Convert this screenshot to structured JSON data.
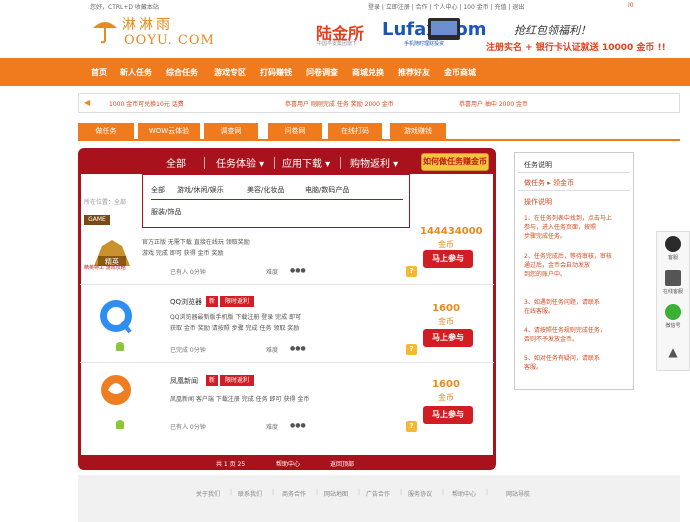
{
  "topbar": {
    "welcome": "您好，CTRL+D 收藏本站",
    "bookmark": "收藏本站",
    "user_links": "登录 | 立即注册 | 合作 | 个人中心 | 100 金币 | 充值 | 退出",
    "vip": "I0"
  },
  "header": {
    "logo_cn": "淋淋雨",
    "logo_en": "OOYU. COM",
    "lu_logo": "陆金所",
    "lu_sub": "中国平安集团旗下",
    "lufax": "Lufax.com",
    "lufax_sub": "手机随时理财投资",
    "slogan1": "抢红包领福利！",
    "slogan2": "注册实名 + 银行卡认证就送 10000 金币 !!"
  },
  "nav": [
    "首页",
    "新人任务",
    "综合任务",
    "游戏专区",
    "打码赚钱",
    "问卷调查",
    "商城兑换",
    "推荐好友",
    "金币商城"
  ],
  "notice": {
    "items": [
      "1000 金币可兑换10元 话费",
      "恭喜用户 刚刚完成 任务 奖励 2000 金币",
      "恭喜用户 抽中 2000 金币"
    ]
  },
  "subtabs": [
    "做任务",
    "WOW云体验",
    "调查网",
    "问卷网",
    "在线打码",
    "游戏赚钱"
  ],
  "panel": {
    "head_items": [
      "全部",
      "任务体验 ▾",
      "应用下载 ▾",
      "购物返利 ▾"
    ],
    "cta": "如何做任务赚金币"
  },
  "dropdown": {
    "row1": [
      "全部",
      "游戏/休闲/娱乐",
      "美容/化妆品",
      "电脑/数码产品"
    ],
    "row2": [
      "服装/饰品"
    ]
  },
  "breadcrumb": "所在位置：全部",
  "tasks": [
    {
      "tag": "GAME",
      "thumb_caption": "精英特工 游戏攻略",
      "title": "",
      "desc1": "官方正版 无需下载 直接在线玩 领取奖励",
      "desc2": "游戏 完成 即可 获得 金币 奖励",
      "meta_time": "已有人 0分钟",
      "meta_diff": "难度",
      "price": "144434000",
      "coin": "金币",
      "join": "马上参与"
    },
    {
      "title": "QQ浏览器",
      "badge_new": "新",
      "badge_hot": "限时返利",
      "desc1": "QQ浏览器最新版手机版 下载注册 登录 完成 即可",
      "desc2": "获取 金币 奖励 请按照 步骤 完成 任务 领取 奖励",
      "meta_time": "已完成 0分钟",
      "meta_diff": "难度",
      "price": "1600",
      "coin": "金币",
      "join": "马上参与"
    },
    {
      "title": "凤凰新闻",
      "badge_new": "新",
      "badge_hot": "限时返利",
      "desc1": "凤凰新闻 客户端 下载注册 完成 任务 即可 获得 金币",
      "desc2": "",
      "meta_time": "已有人 0分钟",
      "meta_diff": "难度",
      "price": "1600",
      "coin": "金币",
      "join": "马上参与"
    }
  ],
  "panel_foot": [
    "共 1 页 25",
    "帮助中心",
    "返回顶部"
  ],
  "sidebar": {
    "title": "任务说明",
    "tabs": "做任务 ▸ 领金币",
    "section": "操作说明",
    "steps": [
      "1、在任务列表中找到，点击马上",
      "参与，进入任务页面，按照",
      "步骤完成任务。",
      "2、任务完成后，等待审核，审核",
      "通过后，金币会自动发放",
      "到您的账户中。",
      "3、如遇到任务问题，请联系",
      "在线客服。",
      "4、请按照任务规则完成任务，",
      "否则不予发放金币。",
      "5、如对任务有疑问，请联系",
      "客服。"
    ]
  },
  "floatbar": [
    "客服",
    "在线客服",
    "微信号",
    "顶部"
  ],
  "footer": [
    "关于我们",
    "联系我们",
    "商务合作",
    "网站地图",
    "广告合作",
    "服务协议",
    "帮助中心",
    "网站导航"
  ],
  "colors": {
    "brand_orange": "#f07a1e",
    "panel_red": "#a8121c",
    "join_red": "#d01e24",
    "price_orange": "#e88a20"
  }
}
